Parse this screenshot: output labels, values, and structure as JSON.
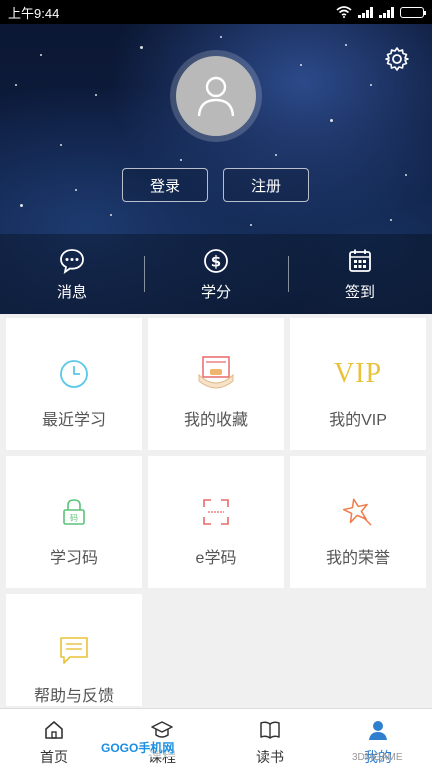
{
  "status": {
    "time": "上午9:44"
  },
  "profile": {
    "login_label": "登录",
    "register_label": "注册"
  },
  "quick": [
    {
      "label": "消息",
      "icon": "chat-bubble-icon"
    },
    {
      "label": "学分",
      "icon": "dollar-circle-icon"
    },
    {
      "label": "签到",
      "icon": "calendar-icon"
    }
  ],
  "menu": [
    {
      "label": "最近学习",
      "icon": "clock-icon",
      "color": "#5ac8e8"
    },
    {
      "label": "我的收藏",
      "icon": "favorites-icon",
      "color": "#e86a6a"
    },
    {
      "label": "我的VIP",
      "icon": "vip-icon",
      "color": "#e8c23a"
    },
    {
      "label": "学习码",
      "icon": "lock-code-icon",
      "color": "#5cc27a"
    },
    {
      "label": "e学码",
      "icon": "scan-icon",
      "color": "#e86a6a"
    },
    {
      "label": "我的荣誉",
      "icon": "star-badge-icon",
      "color": "#ef7c4a"
    },
    {
      "label": "帮助与反馈",
      "icon": "feedback-icon",
      "color": "#e8c23a"
    }
  ],
  "vip_text": "VIP",
  "tabs": [
    {
      "label": "首页",
      "icon": "home-icon"
    },
    {
      "label": "课程",
      "icon": "graduation-cap-icon"
    },
    {
      "label": "读书",
      "icon": "book-icon"
    },
    {
      "label": "我的",
      "icon": "person-icon"
    }
  ],
  "watermarks": {
    "left": "GOGO手机网",
    "right": "3DMGAME"
  },
  "colors": {
    "accent": "#2f7fd0",
    "tile_label": "#555555"
  }
}
